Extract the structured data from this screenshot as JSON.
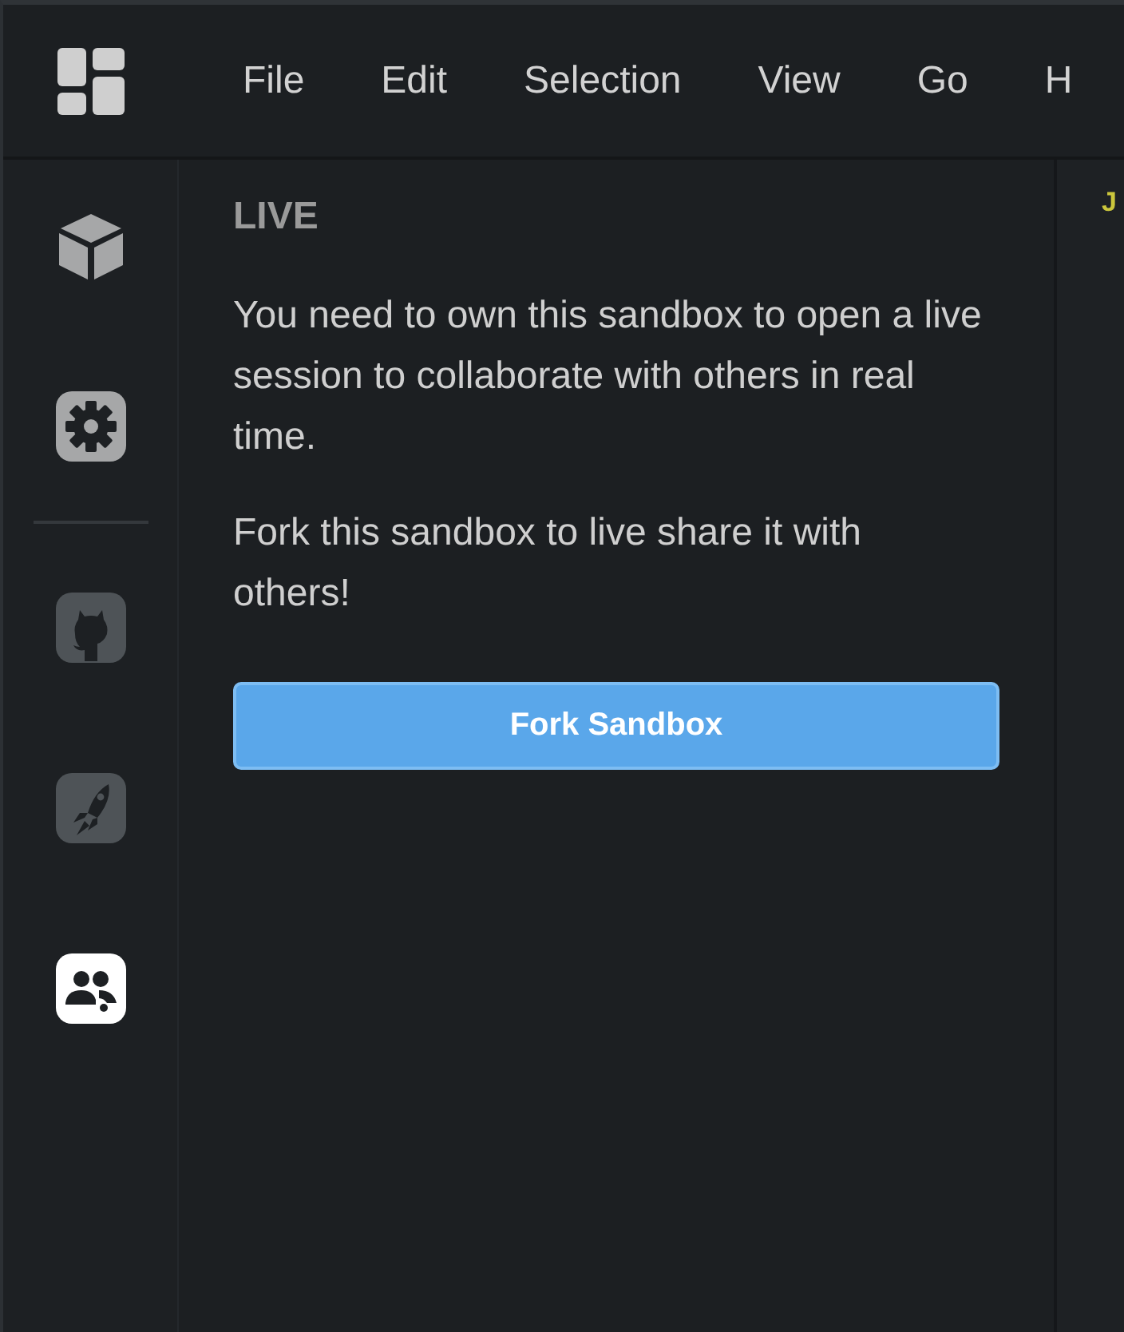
{
  "menu_bar": {
    "items": [
      "File",
      "Edit",
      "Selection",
      "View",
      "Go",
      "H"
    ]
  },
  "activity_bar": {
    "items": [
      {
        "kind": "cube",
        "selected": false,
        "disabled": false
      },
      {
        "kind": "gear",
        "selected": false,
        "disabled": false
      },
      {
        "kind": "divider"
      },
      {
        "kind": "github",
        "selected": false,
        "disabled": true
      },
      {
        "kind": "rocket",
        "selected": false,
        "disabled": true
      },
      {
        "kind": "people",
        "selected": true,
        "disabled": false
      }
    ]
  },
  "panel": {
    "title": "LIVE",
    "paragraphs": [
      "You need to own this sandbox to open a live session to collaborate with others in real time.",
      "Fork this sandbox to live share it with others!"
    ],
    "button": "Fork Sandbox"
  },
  "editor": {
    "tab": "J"
  }
}
